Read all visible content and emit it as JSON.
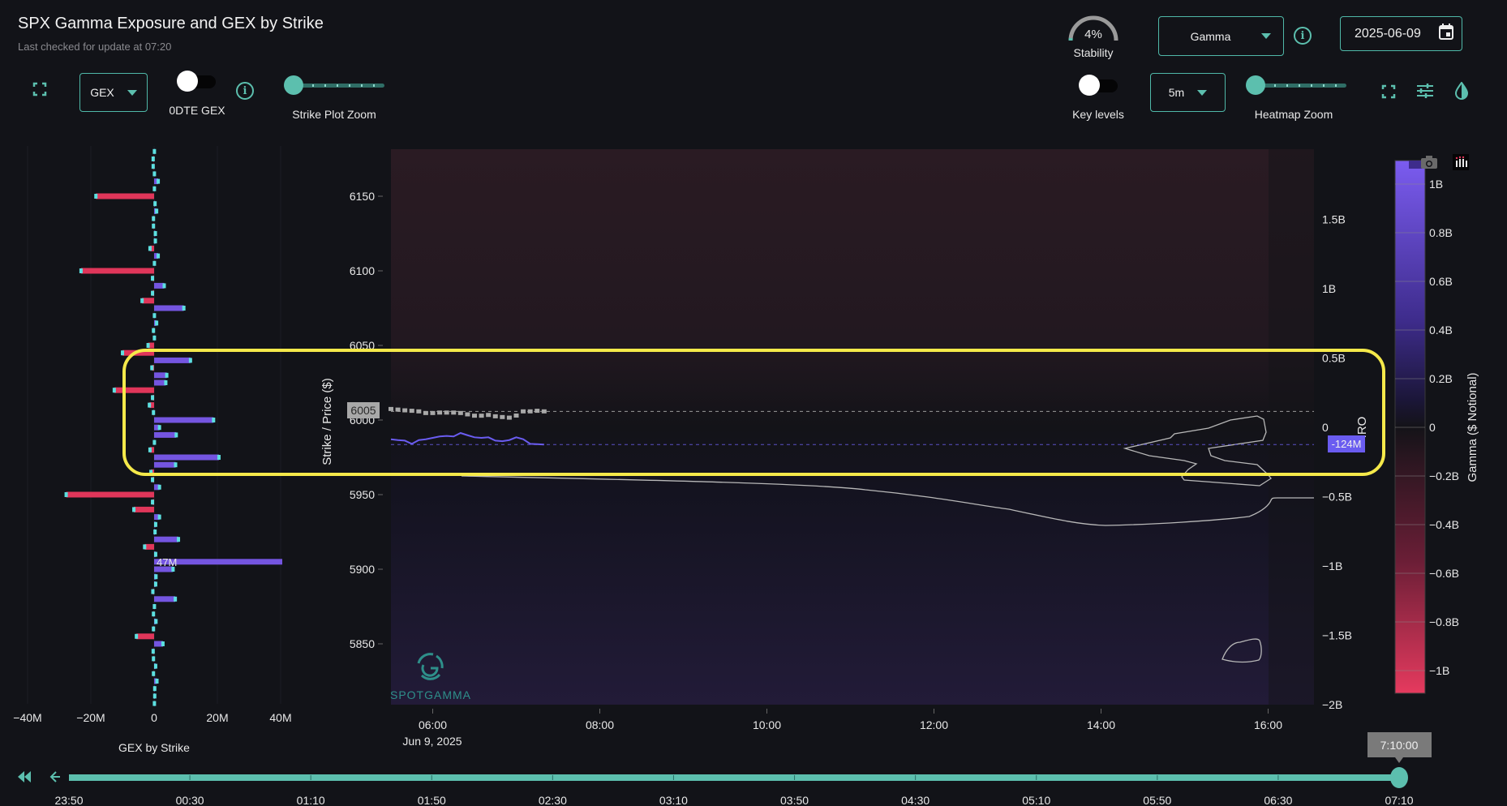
{
  "header": {
    "title": "SPX Gamma Exposure and GEX by Strike",
    "subtitle": "Last checked for update at 07:20"
  },
  "left_controls": {
    "gex_dropdown": "GEX",
    "odte_toggle_label": "0DTE GEX",
    "odte_toggle_on": false,
    "strike_zoom_label": "Strike Plot Zoom",
    "strike_zoom_value": 0
  },
  "right_controls": {
    "stability_value": "4%",
    "stability_fraction": 0.04,
    "stability_label": "Stability",
    "mode_dropdown": "Gamma",
    "date": "2025-06-09",
    "key_levels_label": "Key levels",
    "key_levels_on": false,
    "interval_dropdown": "5m",
    "heatmap_zoom_label": "Heatmap Zoom",
    "heatmap_zoom_value": 0
  },
  "colors": {
    "accent": "#5cbfae",
    "positive": "#7455e0",
    "negative": "#e0365a",
    "marker": "#5ce0e0",
    "highlight": "#f5e94a"
  },
  "chart_data": [
    {
      "type": "bar",
      "orientation": "horizontal",
      "title": "GEX by Strike",
      "xlabel": "GEX by Strike",
      "xlim": [
        -40,
        40
      ],
      "xticks": [
        "−40M",
        "−20M",
        "0",
        "20M",
        "40M"
      ],
      "xtick_values": [
        -40,
        -20,
        0,
        20,
        40
      ],
      "units": "M",
      "annotation": "47M",
      "strikes": [
        6180,
        6175,
        6170,
        6165,
        6160,
        6155,
        6150,
        6145,
        6140,
        6135,
        6130,
        6125,
        6120,
        6115,
        6110,
        6105,
        6100,
        6095,
        6090,
        6085,
        6080,
        6075,
        6070,
        6065,
        6060,
        6055,
        6050,
        6045,
        6040,
        6035,
        6030,
        6025,
        6020,
        6015,
        6010,
        6005,
        6000,
        5995,
        5990,
        5985,
        5980,
        5975,
        5970,
        5965,
        5960,
        5955,
        5950,
        5945,
        5940,
        5935,
        5930,
        5925,
        5920,
        5915,
        5910,
        5905,
        5900,
        5895,
        5890,
        5885,
        5880,
        5875,
        5870,
        5865,
        5860,
        5855,
        5850,
        5845,
        5840,
        5835,
        5830,
        5825,
        5820,
        5815,
        5810
      ],
      "values": [
        0.1,
        -0.3,
        -0.3,
        0.1,
        1.3,
        0.1,
        -18.4,
        0.3,
        0.8,
        -0.2,
        -0.2,
        0.4,
        0.4,
        -1.3,
        1.3,
        0.1,
        -23.1,
        -0.5,
        3.2,
        -0.5,
        -3.8,
        9.4,
        0.1,
        0.8,
        -0.2,
        0.1,
        -1.9,
        -10,
        11.5,
        -0.7,
        4,
        3.7,
        -12.6,
        -0.5,
        -1.5,
        -0.2,
        18.8,
        1.7,
        7,
        0.1,
        -1.3,
        20.5,
        6.8,
        -1,
        -0.5,
        1.7,
        -27.8,
        -0.5,
        -6.4,
        1.7,
        0.5,
        0.3,
        7.7,
        -3,
        0.5,
        47,
        6,
        0.6,
        0.5,
        -0.4,
        6.7,
        0.1,
        -0.2,
        0.6,
        -0.2,
        -5.6,
        2.8,
        -0.3,
        -0.2,
        0.5,
        -0.2,
        0.9,
        0.2,
        0.2,
        0.1
      ]
    },
    {
      "type": "heatmap",
      "title": "Gamma heatmap",
      "ylabel": "Strike / Price ($)",
      "y2label": "IRO",
      "colorbar_label": "Gamma ($ Notional)",
      "ylim": [
        5809,
        6181
      ],
      "yticks": [
        6150,
        6100,
        6050,
        6000,
        5950,
        5900,
        5850
      ],
      "y2lim": [
        -2,
        2
      ],
      "y2ticks": [
        "1.5B",
        "1B",
        "0.5B",
        "0",
        "−0.5B",
        "−1B",
        "−1.5B",
        "−2B"
      ],
      "y2tick_values": [
        1.5,
        1,
        0.5,
        0,
        -0.5,
        -1,
        -1.5,
        -2
      ],
      "colorbar_range": [
        -1.1,
        1.1
      ],
      "colorbar_ticks": [
        "1B",
        "0.8B",
        "0.6B",
        "0.4B",
        "0.2B",
        "0",
        "−0.2B",
        "−0.4B",
        "−0.6B",
        "−0.8B",
        "−1B"
      ],
      "colorbar_tick_values": [
        1,
        0.8,
        0.6,
        0.4,
        0.2,
        0,
        -0.2,
        -0.4,
        -0.6,
        -0.8,
        -1
      ],
      "xlim_hours": [
        5.5,
        16.55
      ],
      "xticks": [
        "06:00",
        "08:00",
        "10:00",
        "12:00",
        "14:00",
        "16:00"
      ],
      "xtick_hours": [
        6,
        8,
        10,
        12,
        14,
        16
      ],
      "x_date_label": "Jun 9, 2025",
      "price_label": "6005",
      "price_level": 6005.8,
      "iro_label": "-124M",
      "iro_level_M": -124,
      "time_start_hour": 5.5,
      "time_step_min": 5,
      "price_series": [
        6007.4,
        6007,
        6006.5,
        6006.2,
        6005.8,
        6004.7,
        6004.7,
        6005,
        6005,
        6005,
        6004.7,
        6003.8,
        6002.9,
        6002.9,
        6003.4,
        6002.5,
        6002,
        6001.6,
        6003,
        6005.8,
        6005.8,
        6006.2,
        6005.8
      ],
      "iro_series_M": [
        -86,
        -92,
        -96,
        -119,
        -92,
        -86,
        -76,
        -66,
        -62,
        -66,
        -41,
        -57,
        -72,
        -76,
        -72,
        -96,
        -100,
        -92,
        -72,
        -86,
        -119,
        -121,
        -124
      ]
    }
  ],
  "watermark": "SPOTGAMMA",
  "timeline": {
    "labels": [
      "23:50",
      "00:30",
      "01:10",
      "01:50",
      "02:30",
      "03:10",
      "03:50",
      "04:30",
      "05:10",
      "05:50",
      "06:30",
      "07:10"
    ],
    "current": "7:10:00",
    "position_fraction": 1.0
  }
}
